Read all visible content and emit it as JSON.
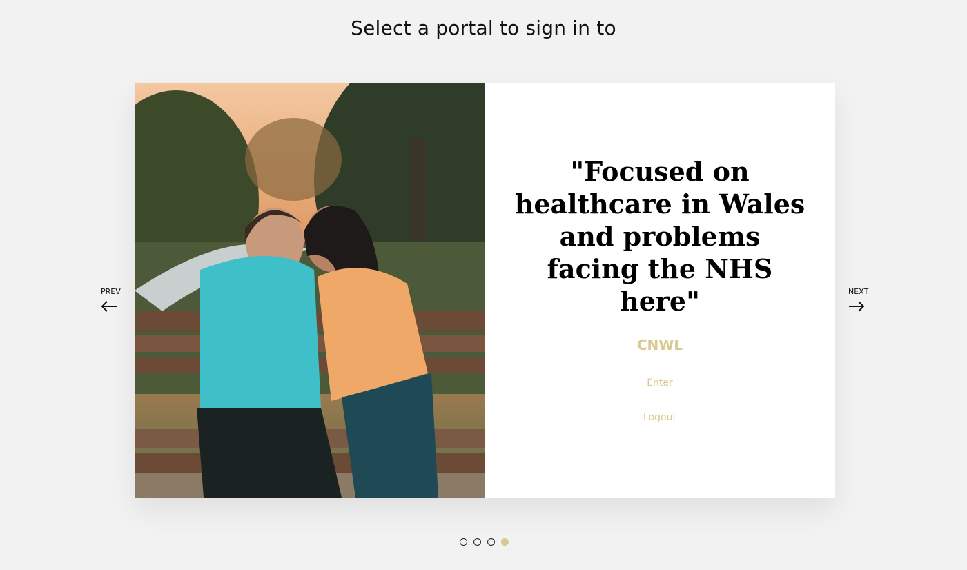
{
  "header": {
    "title": "Select a portal to sign in to"
  },
  "carousel": {
    "prev_label": "PREV",
    "next_label": "NEXT",
    "slide": {
      "quote": "\"Focused on healthcare in Wales and problems facing the NHS here\"",
      "portal_name": "CNWL",
      "enter_label": "Enter",
      "logout_label": "Logout"
    },
    "dots": [
      {
        "active": false
      },
      {
        "active": false
      },
      {
        "active": false
      },
      {
        "active": true
      }
    ]
  },
  "colors": {
    "background": "#f2f2f2",
    "accent": "#d9c98e",
    "card": "#ffffff",
    "text": "#111111"
  },
  "icons": {
    "prev": "arrow-left-icon",
    "next": "arrow-right-icon"
  }
}
